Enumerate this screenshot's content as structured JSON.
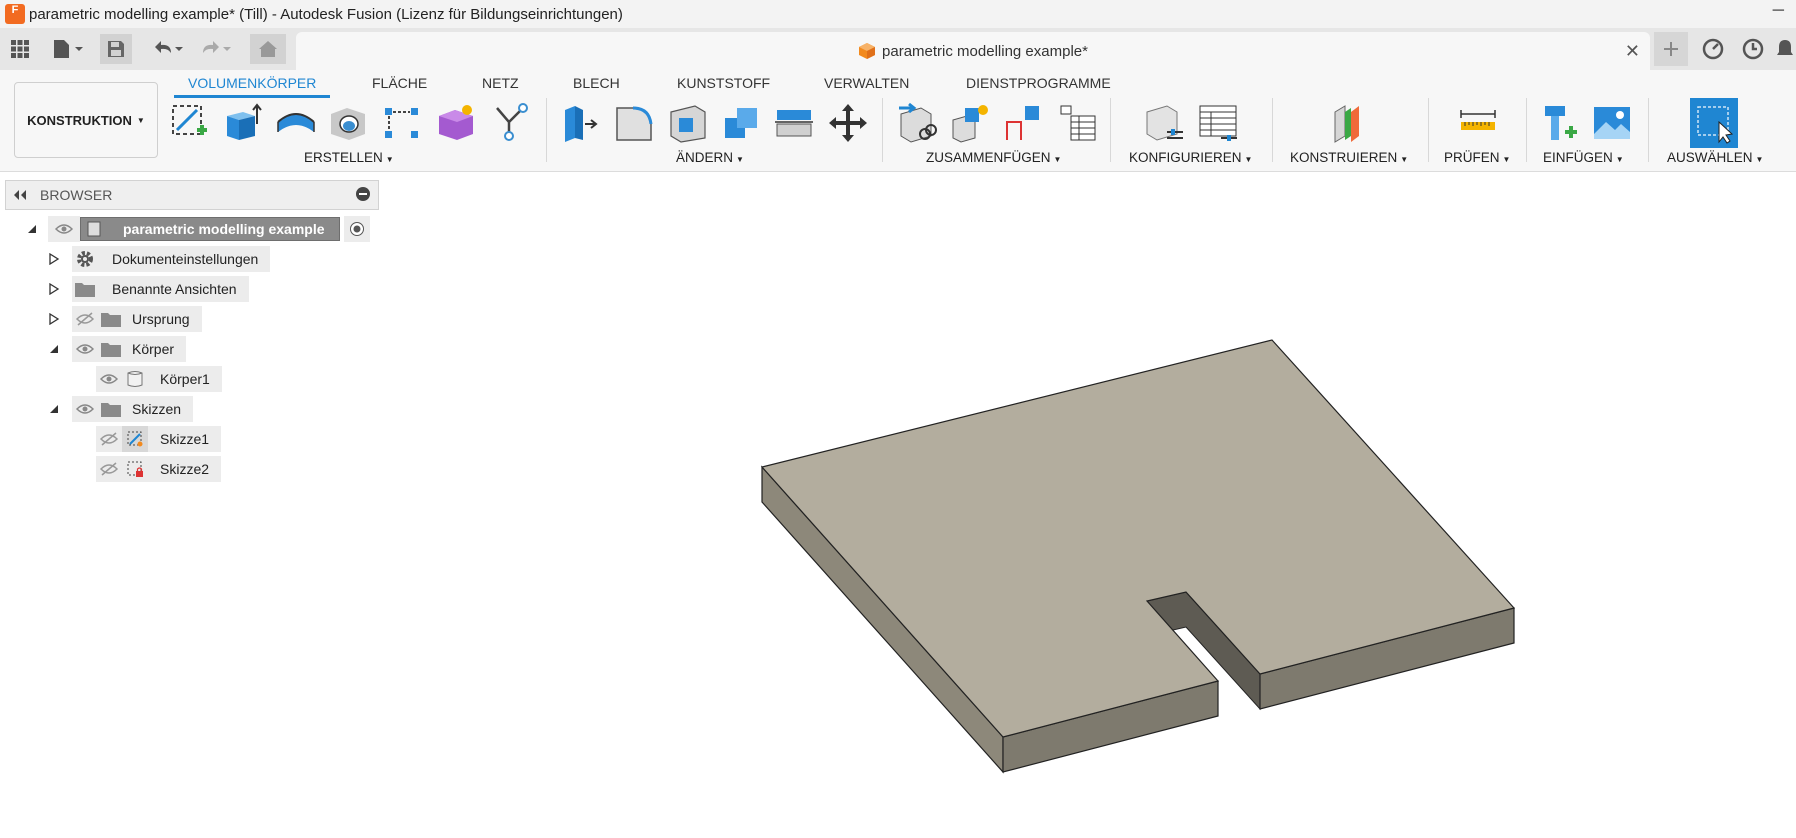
{
  "window": {
    "title": "parametric modelling example* (Till) - Autodesk Fusion (Lizenz für Bildungseinrichtungen)",
    "minimize": "─",
    "logo_letter": "F"
  },
  "document_tab": {
    "title": "parametric modelling example*",
    "close": "✕"
  },
  "ribbon": {
    "workspace": "KONSTRUKTION",
    "tabs": [
      "VOLUMENKÖRPER",
      "FLÄCHE",
      "NETZ",
      "BLECH",
      "KUNSTSTOFF",
      "VERWALTEN",
      "DIENSTPROGRAMME"
    ],
    "active_tab": "VOLUMENKÖRPER",
    "groups": [
      "ERSTELLEN",
      "ÄNDERN",
      "ZUSAMMENFÜGEN",
      "KONFIGURIEREN",
      "KONSTRUIEREN",
      "PRÜFEN",
      "EINFÜGEN",
      "AUSWÄHLEN"
    ]
  },
  "browser": {
    "title": "BROWSER",
    "root": "parametric modelling example",
    "items": [
      {
        "label": "Dokumenteinstellungen",
        "icon": "gear-icon"
      },
      {
        "label": "Benannte Ansichten",
        "icon": "folder-icon"
      },
      {
        "label": "Ursprung",
        "icon": "folder-icon"
      },
      {
        "label": "Körper",
        "icon": "folder-icon"
      },
      {
        "label": "Körper1",
        "icon": "body-icon"
      },
      {
        "label": "Skizzen",
        "icon": "folder-icon"
      },
      {
        "label": "Skizze1",
        "icon": "sketch-icon"
      },
      {
        "label": "Skizze2",
        "icon": "sketch-icon"
      }
    ]
  },
  "colors": {
    "accent": "#1f86d2",
    "model_top": "#b3ad9e",
    "model_side": "#8d887a",
    "model_front": "#7e7a6e"
  }
}
